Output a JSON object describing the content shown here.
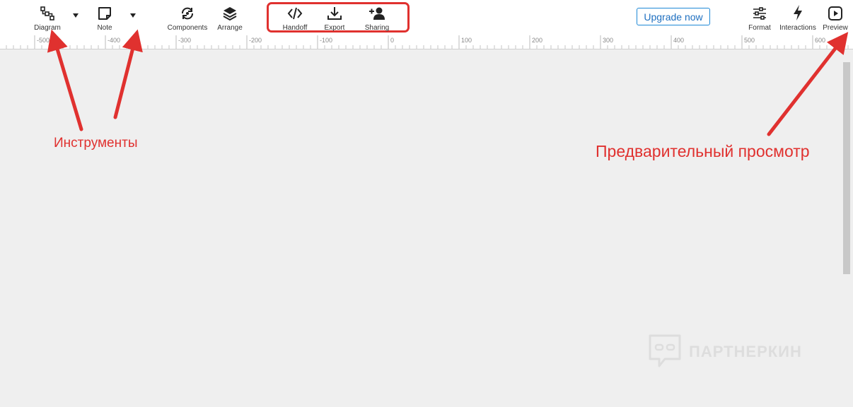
{
  "toolbar": {
    "diagram_label": "Diagram",
    "note_label": "Note",
    "components_label": "Components",
    "arrange_label": "Arrange",
    "handoff_label": "Handoff",
    "export_label": "Export",
    "sharing_label": "Sharing",
    "upgrade_label": "Upgrade now",
    "format_label": "Format",
    "interactions_label": "Interactions",
    "preview_label": "Preview"
  },
  "ruler": {
    "ticks": [
      "-500",
      "-400",
      "-300",
      "-200",
      "-100",
      "0",
      "100",
      "200",
      "300",
      "400",
      "500",
      "600"
    ]
  },
  "annotations": {
    "tools": "Инструменты",
    "preview": "Предварительный просмотр"
  },
  "watermark": {
    "text": "ПАРТНЕРКИН"
  },
  "colors": {
    "accent_red": "#e0312f",
    "upgrade_blue": "#1e88d6",
    "canvas_bg": "#efefef"
  }
}
